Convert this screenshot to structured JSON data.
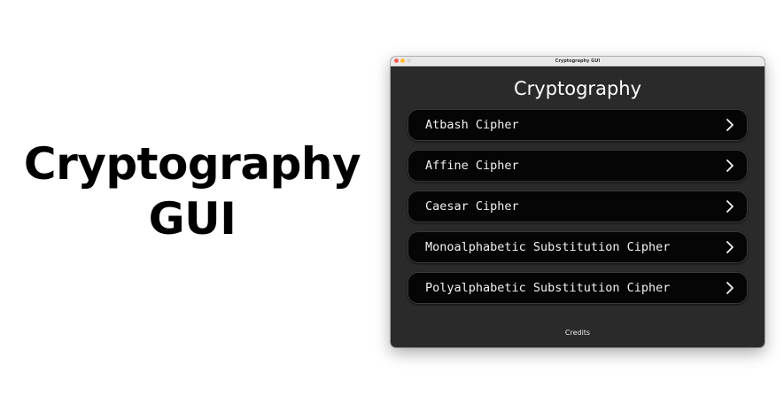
{
  "hero": {
    "line1": "Cryptography",
    "line2": "GUI"
  },
  "window": {
    "title": "Cryptography GUI",
    "heading": "Cryptography",
    "menu": [
      {
        "label": "Atbash Cipher",
        "icon": "chevron-right-icon"
      },
      {
        "label": "Affine Cipher",
        "icon": "chevron-right-icon"
      },
      {
        "label": "Caesar Cipher",
        "icon": "chevron-right-icon"
      },
      {
        "label": "Monoalphabetic Substitution Cipher",
        "icon": "chevron-right-icon"
      },
      {
        "label": "Polyalphabetic Substitution Cipher",
        "icon": "chevron-right-icon"
      }
    ],
    "credits": "Credits"
  },
  "colors": {
    "window_bg": "#2a2a2a",
    "button_bg": "#050505",
    "close": "#fe5f57",
    "minimize": "#febc2e",
    "maximize": "#d7d7d7"
  }
}
